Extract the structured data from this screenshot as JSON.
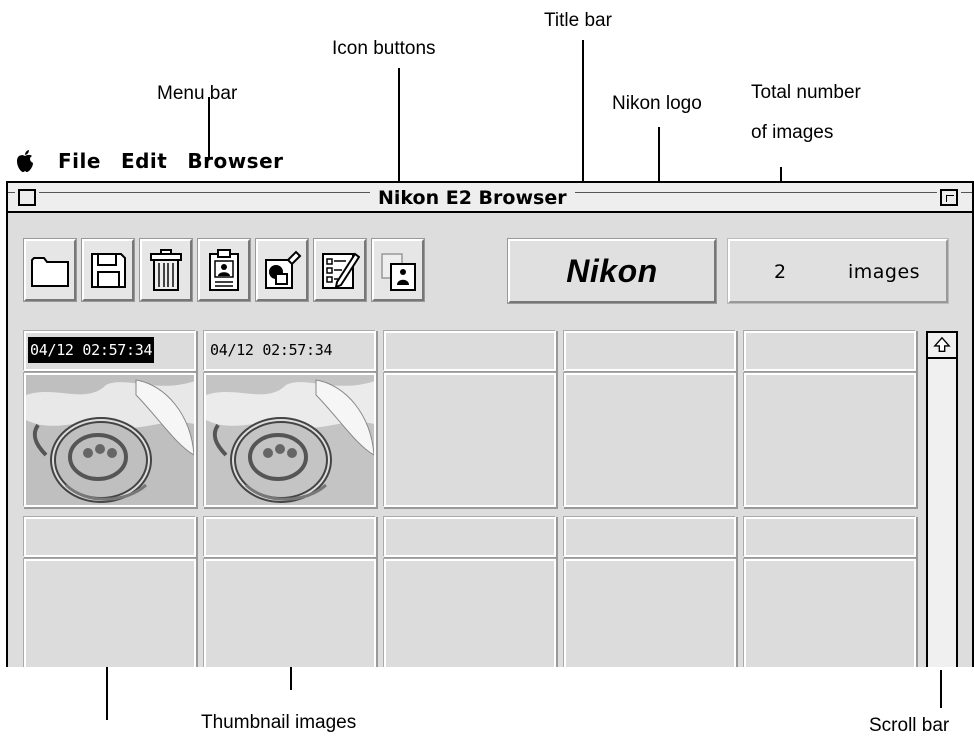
{
  "menubar": {
    "apple_icon": "apple-icon",
    "items": [
      "File",
      "Edit",
      "Browser"
    ]
  },
  "window": {
    "title": "Nikon E2 Browser"
  },
  "toolbar": {
    "buttons": [
      {
        "name": "open-folder-button",
        "icon": "folder-icon"
      },
      {
        "name": "save-button",
        "icon": "floppy-disk-icon"
      },
      {
        "name": "delete-button",
        "icon": "trash-can-icon"
      },
      {
        "name": "clipboard-button",
        "icon": "clipboard-icon"
      },
      {
        "name": "export-button",
        "icon": "export-icon"
      },
      {
        "name": "edit-info-button",
        "icon": "checklist-pencil-icon"
      },
      {
        "name": "image-view-button",
        "icon": "image-person-icon"
      }
    ],
    "logo_text": "Nikon",
    "image_count": "2",
    "image_count_unit": "images"
  },
  "grid": {
    "thumbnails": [
      {
        "date": "04/12 02:57:34",
        "selected": true
      },
      {
        "date": "04/12 02:57:34",
        "selected": false
      }
    ]
  },
  "callouts": {
    "title_bar": "Title bar",
    "icon_buttons": "Icon buttons",
    "menu_bar": "Menu bar",
    "nikon_logo": "Nikon logo",
    "total_images_line1": "Total number",
    "total_images_line2": "of images",
    "thumbnail_images": "Thumbnail images",
    "scroll_bar": "Scroll bar"
  }
}
